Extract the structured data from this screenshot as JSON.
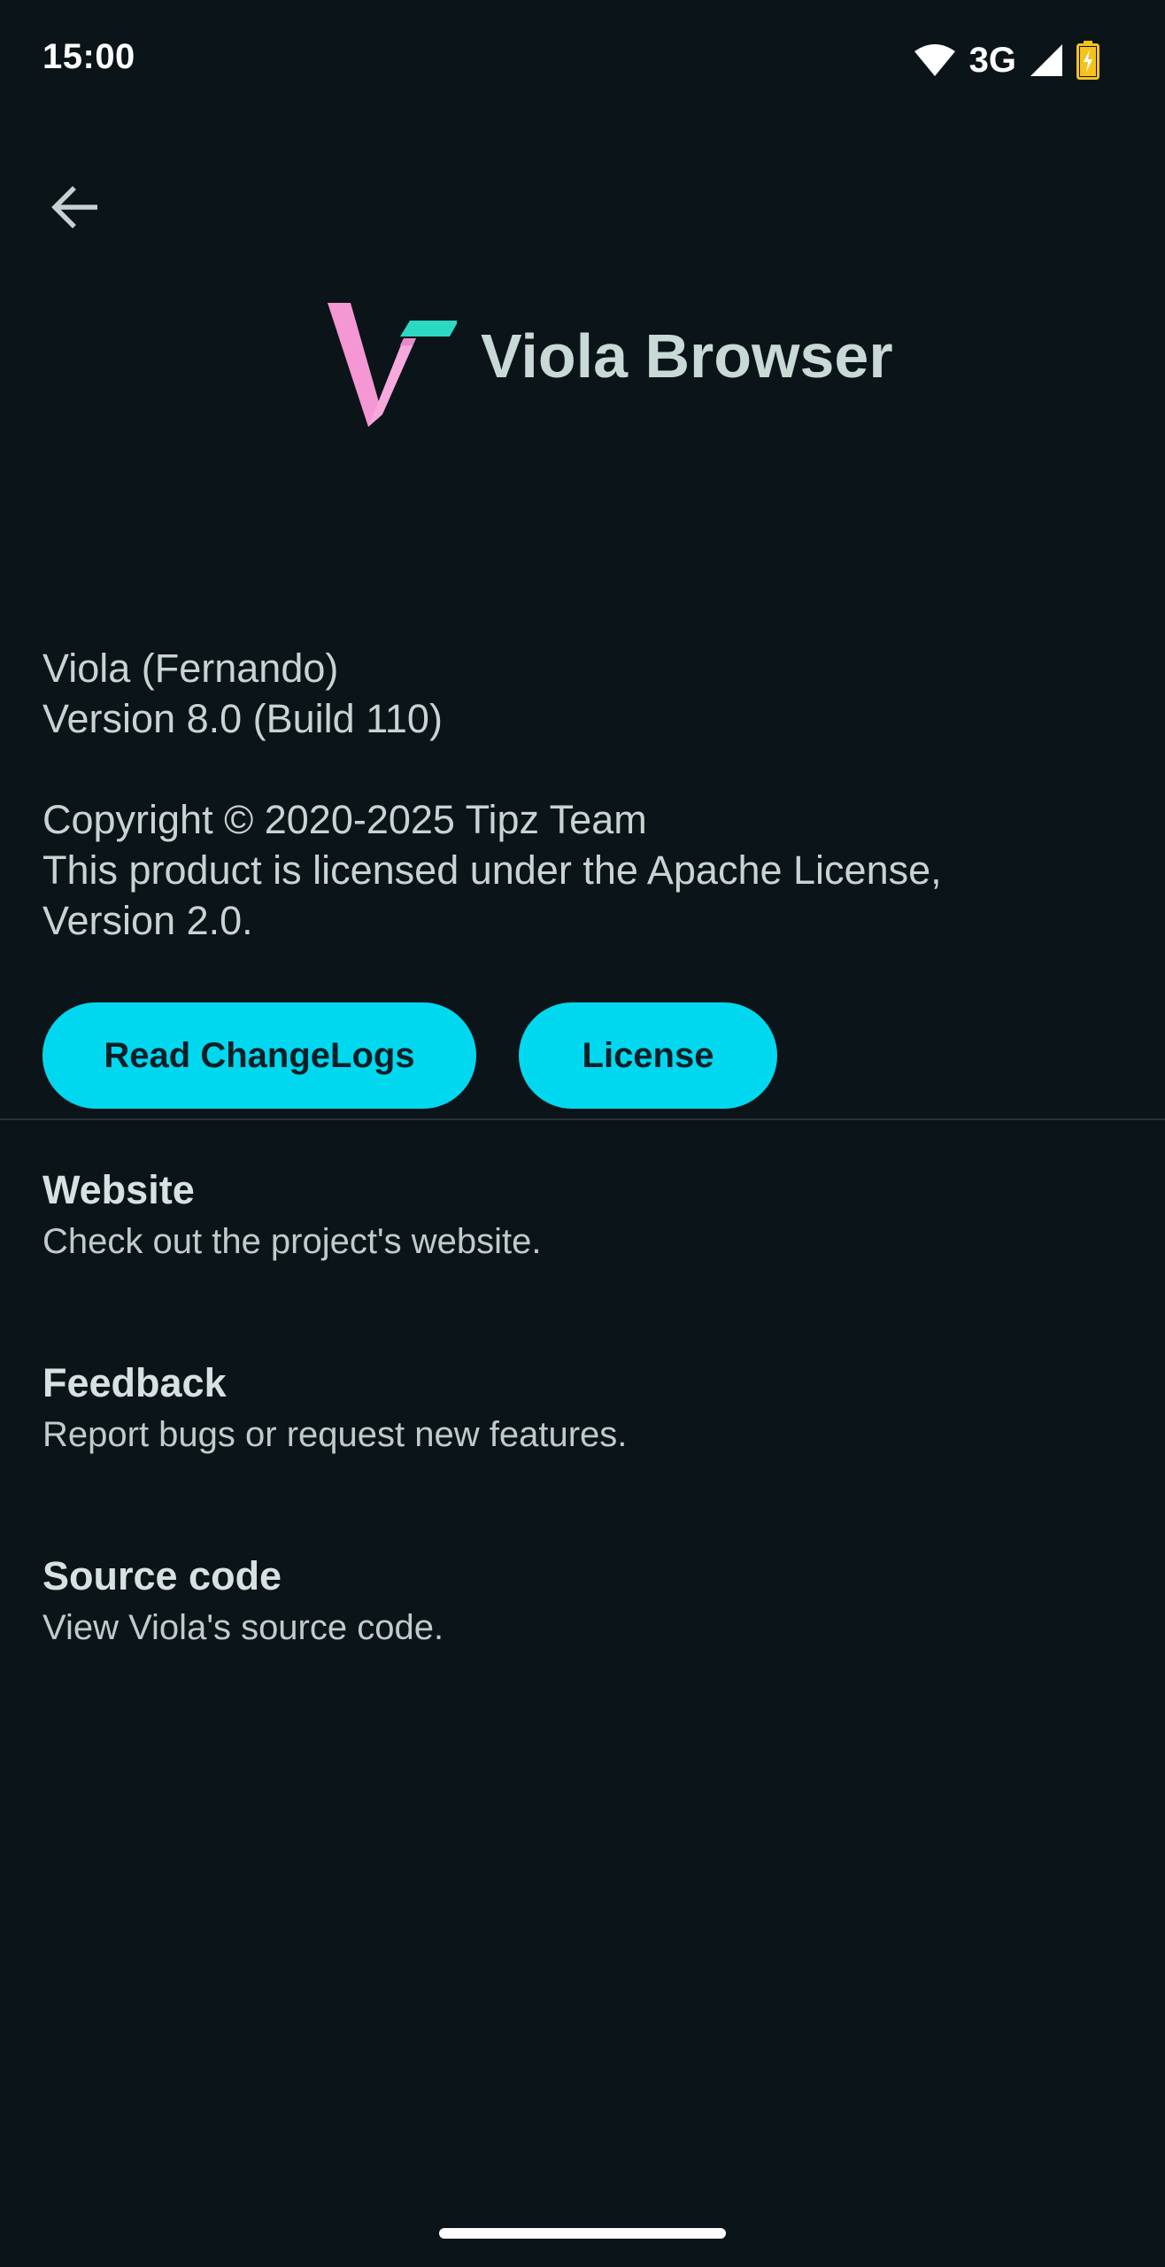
{
  "status_bar": {
    "time": "15:00",
    "network": "3G",
    "icons": [
      "wifi-icon",
      "signal-icon",
      "battery-charging-icon"
    ]
  },
  "header": {
    "back_icon": "arrow-back-icon",
    "app_name": "Viola Browser",
    "logo_icon": "viola-logo-icon"
  },
  "info": {
    "name_line": "Viola (Fernando)",
    "version_line": "Version 8.0 (Build 110)",
    "copyright_line": "Copyright © 2020-2025 Tipz Team",
    "license_line_1": "This product is licensed under the Apache License,",
    "license_line_2": "Version 2.0."
  },
  "buttons": {
    "changelogs": "Read ChangeLogs",
    "license": "License"
  },
  "list": [
    {
      "title": "Website",
      "subtitle": "Check out the project's website."
    },
    {
      "title": "Feedback",
      "subtitle": "Report bugs or request new features."
    },
    {
      "title": "Source code",
      "subtitle": "View Viola's source code."
    }
  ],
  "colors": {
    "background": "#0b1418",
    "accent": "#00d8ef",
    "logo_pink": "#f497d2",
    "logo_teal": "#2ad8c4"
  }
}
